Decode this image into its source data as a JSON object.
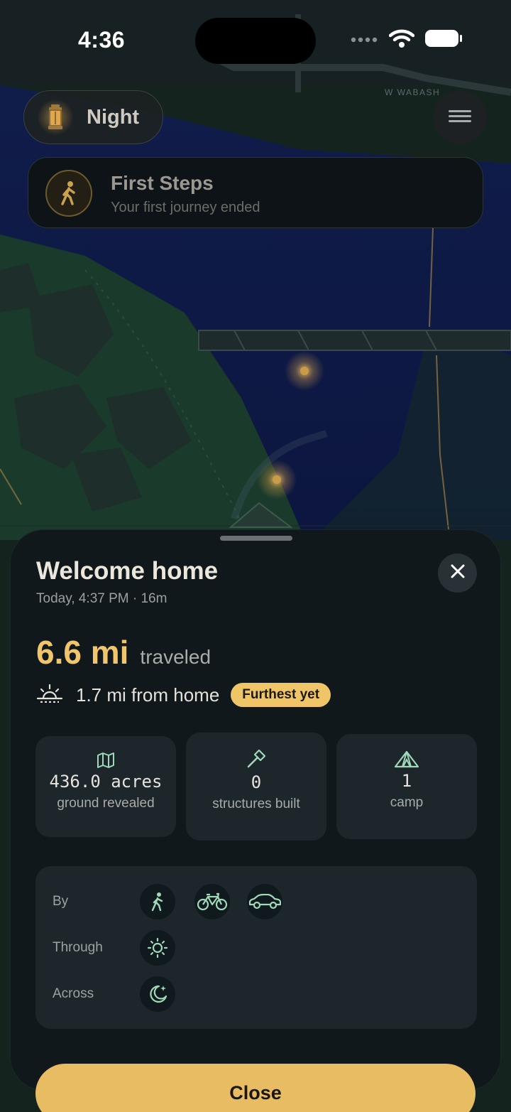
{
  "status_bar": {
    "time": "4:36"
  },
  "map": {
    "street_label": "W WABASH"
  },
  "time_of_day": {
    "label": "Night",
    "icon": "lantern-icon"
  },
  "achievement": {
    "title": "First Steps",
    "subtitle": "Your first journey ended",
    "icon": "walking-person-icon"
  },
  "summary": {
    "title": "Welcome home",
    "meta": "Today, 4:37 PM · 16m",
    "distance_value": "6.6 mi",
    "distance_label": "traveled",
    "from_home": "1.7 mi from home",
    "badge": "Furthest yet",
    "stats": [
      {
        "icon": "map-icon",
        "value": "436.0 acres",
        "label": "ground revealed"
      },
      {
        "icon": "hammer-icon",
        "value": "0",
        "label": "structures built"
      },
      {
        "icon": "tent-icon",
        "value": "1",
        "label": "camp"
      }
    ],
    "modes": {
      "by_label": "By",
      "through_label": "Through",
      "across_label": "Across",
      "by_icons": [
        "walking-icon",
        "bicycle-icon",
        "car-icon"
      ],
      "through_icons": [
        "sun-icon"
      ],
      "across_icons": [
        "moon-star-icon"
      ]
    },
    "close_label": "Close"
  },
  "colors": {
    "accent": "#f0c567",
    "sheet_bg": "#10181c",
    "tile_bg": "#1d262b",
    "icon_green": "#9fd9b8"
  }
}
